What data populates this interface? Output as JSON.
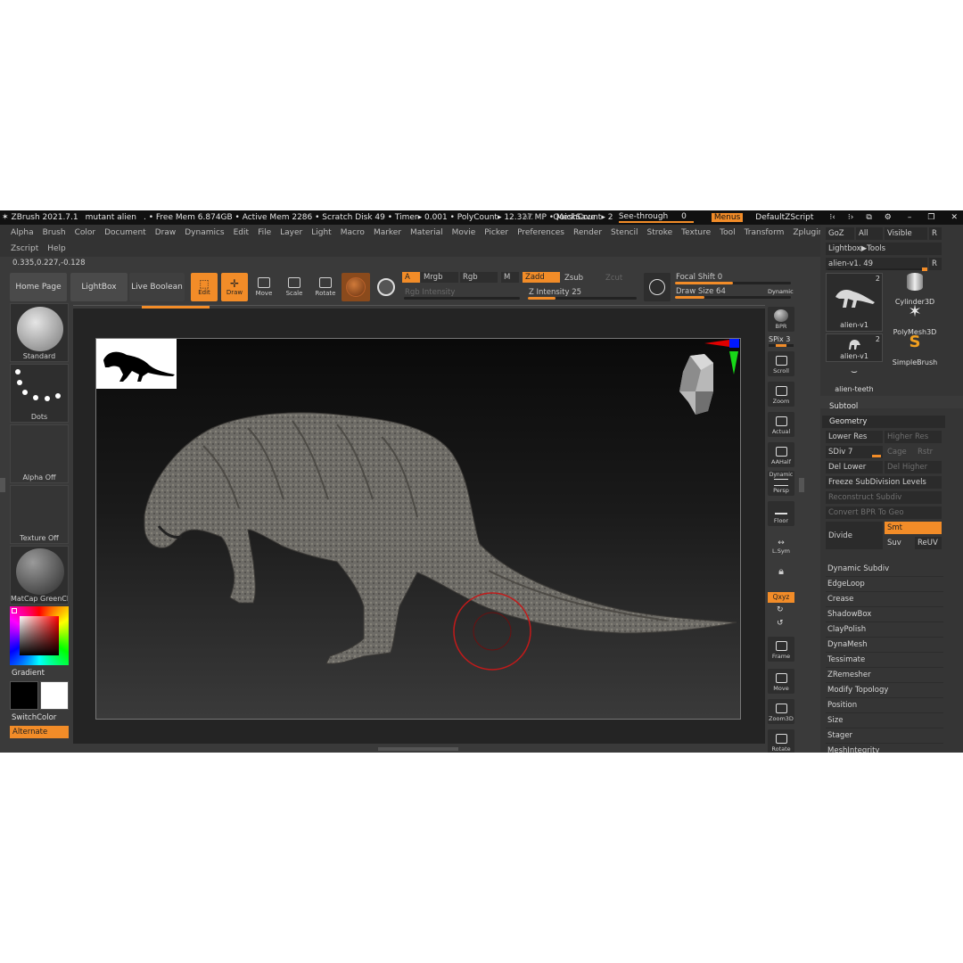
{
  "titlebar": {
    "app": "ZBrush 2021.7.1",
    "doc": "mutant alien",
    "stats": ". • Free Mem 6.874GB • Active Mem 2286 • Scratch Disk 49 •  Timer▸ 0.001 • PolyCount▸ 12.327 MP  • MeshCount▸ 2",
    "ac": "AC",
    "quicksave": "QuickSave",
    "see_through": "See-through",
    "see_through_value": "0",
    "menus": "Menus",
    "script": "DefaultZScript"
  },
  "menus": [
    "Alpha",
    "Brush",
    "Color",
    "Document",
    "Draw",
    "Dynamics",
    "Edit",
    "File",
    "Layer",
    "Light",
    "Macro",
    "Marker",
    "Material",
    "Movie",
    "Picker",
    "Preferences",
    "Render",
    "Stencil",
    "Stroke",
    "Texture",
    "Tool",
    "Transform",
    "Zplugin"
  ],
  "menus_row2": [
    "Zscript",
    "Help"
  ],
  "coords": "0.335,0.227,-0.128",
  "toolbar": {
    "home": "Home Page",
    "lightbox": "LightBox",
    "live_boolean": "Live Boolean",
    "edit": "Edit",
    "draw": "Draw",
    "move": "Move",
    "scale": "Scale",
    "rotate": "Rotate",
    "a": "A",
    "mrgb": "Mrgb",
    "rgb": "Rgb",
    "m": "M",
    "zadd": "Zadd",
    "zsub": "Zsub",
    "zcut": "Zcut",
    "rgb_intensity": "Rgb Intensity",
    "z_intensity": "Z Intensity 25",
    "focal_shift": "Focal Shift 0",
    "draw_size": "Draw Size 64",
    "dynamic": "Dynamic",
    "z_intensity_level": 0.25,
    "focal_shift_level": 0.5,
    "draw_size_level": 0.25
  },
  "left_shelf": {
    "standard": "Standard",
    "dots": "Dots",
    "alpha_off": "Alpha Off",
    "texture_off": "Texture Off",
    "matcap": "MatCap GreenCl",
    "gradient": "Gradient",
    "switchcolor": "SwitchColor",
    "alternate": "Alternate"
  },
  "right_shelf": {
    "bpr": "BPR",
    "spix": "SPix 3",
    "scroll": "Scroll",
    "zoom": "Zoom",
    "actual": "Actual",
    "aahalf": "AAHalf",
    "dynamic": "Dynamic",
    "persp": "Persp",
    "floor": "Floor",
    "lsym": "L.Sym",
    "xyz": "Qxyz",
    "frame": "Frame",
    "move": "Move",
    "zoom3d": "Zoom3D",
    "rotate": "Rotate"
  },
  "tool_panel": {
    "goz": "GoZ",
    "all": "All",
    "visible": "Visible",
    "r": "R",
    "lightbox_tools": "Lightbox▶Tools",
    "current_tool": "alien-v1. 49",
    "tools": [
      {
        "name": "alien-v1",
        "count": "2"
      },
      {
        "name": "Cylinder3D"
      },
      {
        "name": "PolyMesh3D"
      },
      {
        "name": "alien-v1",
        "count": "2"
      },
      {
        "name": "SimpleBrush"
      },
      {
        "name": "alien-teeth"
      }
    ],
    "subtool": "Subtool",
    "geometry": "Geometry",
    "lower_res": "Lower Res",
    "higher_res": "Higher Res",
    "sdiv": "SDiv 7",
    "cage": "Cage",
    "rstr": "Rstr",
    "del_lower": "Del Lower",
    "del_higher": "Del Higher",
    "freeze": "Freeze SubDivision Levels",
    "reconstruct": "Reconstruct Subdiv",
    "convert_bpr": "Convert BPR To Geo",
    "divide": "Divide",
    "smt": "Smt",
    "suv": "Suv",
    "reuv": "ReUV",
    "geom_items": [
      "Dynamic Subdiv",
      "EdgeLoop",
      "Crease",
      "ShadowBox",
      "ClayPolish",
      "DynaMesh",
      "Tessimate",
      "ZRemesher",
      "Modify Topology",
      "Position",
      "Size",
      "Stager",
      "MeshIntegrity"
    ]
  }
}
